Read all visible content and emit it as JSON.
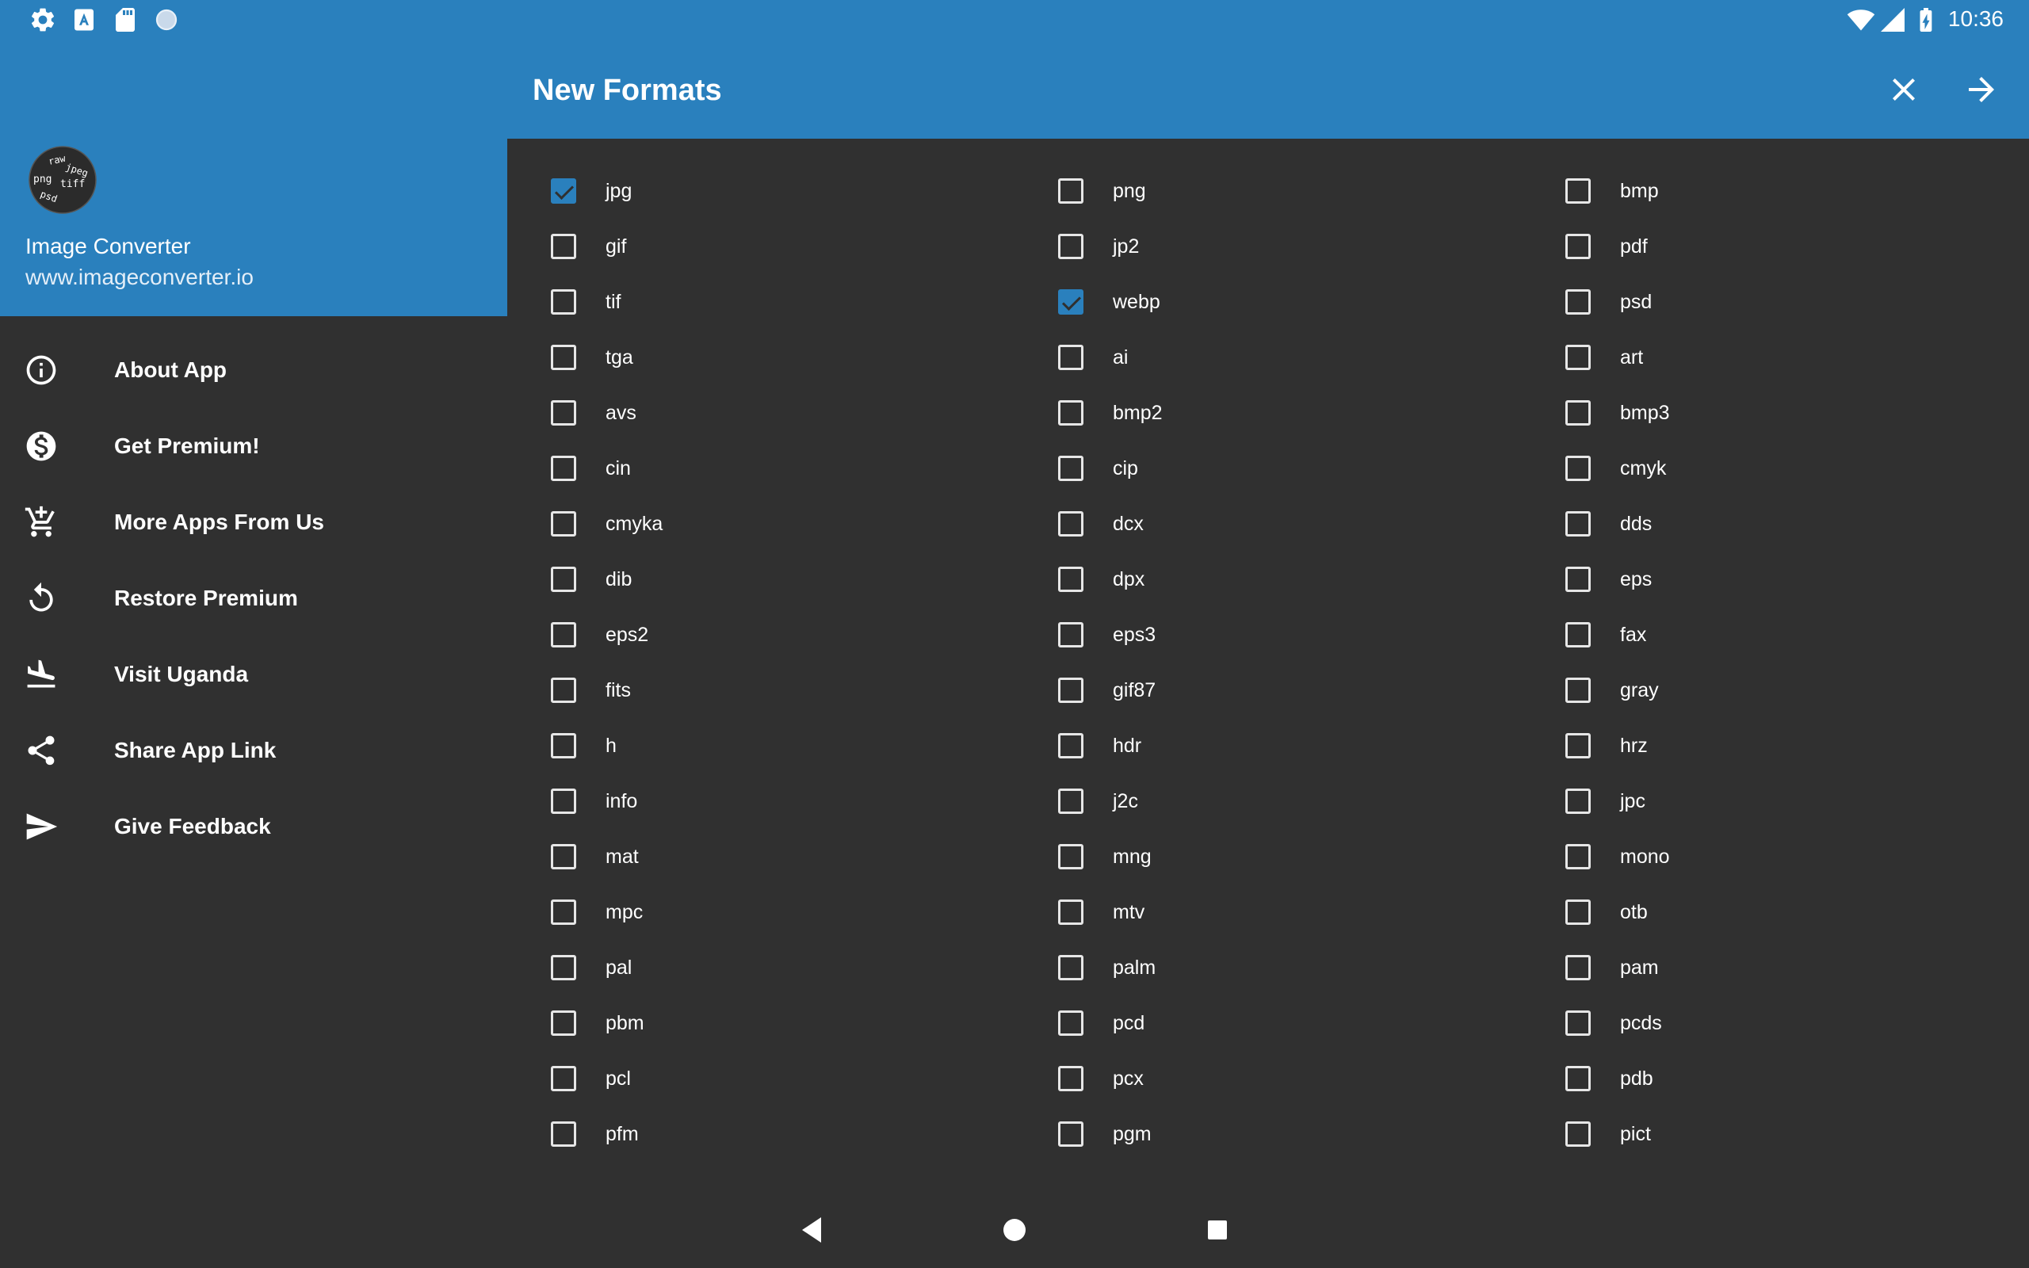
{
  "status_bar": {
    "time": "10:36",
    "left_icons": [
      "gear-icon",
      "font-icon",
      "sd-card-icon",
      "circle-icon"
    ],
    "right_icons": [
      "wifi-icon",
      "signal-icon",
      "battery-charging-icon"
    ]
  },
  "drawer": {
    "app_name": "Image Converter",
    "app_url": "www.imageconverter.io",
    "logo_words": [
      "raw",
      "jpeg",
      "png",
      "tiff",
      "psd"
    ],
    "menu": [
      {
        "label": "About App",
        "icon": "info-icon"
      },
      {
        "label": "Get Premium!",
        "icon": "dollar-icon"
      },
      {
        "label": "More Apps From Us",
        "icon": "add-cart-icon"
      },
      {
        "label": "Restore Premium",
        "icon": "restore-icon"
      },
      {
        "label": "Visit Uganda",
        "icon": "flight-land-icon"
      },
      {
        "label": "Share App Link",
        "icon": "share-icon"
      },
      {
        "label": "Give Feedback",
        "icon": "send-icon"
      }
    ]
  },
  "dialog": {
    "title": "New Formats",
    "close_icon": "close-icon",
    "next_icon": "arrow-forward-icon",
    "formats": [
      {
        "label": "jpg",
        "checked": true
      },
      {
        "label": "png",
        "checked": false
      },
      {
        "label": "bmp",
        "checked": false
      },
      {
        "label": "gif",
        "checked": false
      },
      {
        "label": "jp2",
        "checked": false
      },
      {
        "label": "pdf",
        "checked": false
      },
      {
        "label": "tif",
        "checked": false
      },
      {
        "label": "webp",
        "checked": true
      },
      {
        "label": "psd",
        "checked": false
      },
      {
        "label": "tga",
        "checked": false
      },
      {
        "label": "ai",
        "checked": false
      },
      {
        "label": "art",
        "checked": false
      },
      {
        "label": "avs",
        "checked": false
      },
      {
        "label": "bmp2",
        "checked": false
      },
      {
        "label": "bmp3",
        "checked": false
      },
      {
        "label": "cin",
        "checked": false
      },
      {
        "label": "cip",
        "checked": false
      },
      {
        "label": "cmyk",
        "checked": false
      },
      {
        "label": "cmyka",
        "checked": false
      },
      {
        "label": "dcx",
        "checked": false
      },
      {
        "label": "dds",
        "checked": false
      },
      {
        "label": "dib",
        "checked": false
      },
      {
        "label": "dpx",
        "checked": false
      },
      {
        "label": "eps",
        "checked": false
      },
      {
        "label": "eps2",
        "checked": false
      },
      {
        "label": "eps3",
        "checked": false
      },
      {
        "label": "fax",
        "checked": false
      },
      {
        "label": "fits",
        "checked": false
      },
      {
        "label": "gif87",
        "checked": false
      },
      {
        "label": "gray",
        "checked": false
      },
      {
        "label": "h",
        "checked": false
      },
      {
        "label": "hdr",
        "checked": false
      },
      {
        "label": "hrz",
        "checked": false
      },
      {
        "label": "info",
        "checked": false
      },
      {
        "label": "j2c",
        "checked": false
      },
      {
        "label": "jpc",
        "checked": false
      },
      {
        "label": "mat",
        "checked": false
      },
      {
        "label": "mng",
        "checked": false
      },
      {
        "label": "mono",
        "checked": false
      },
      {
        "label": "mpc",
        "checked": false
      },
      {
        "label": "mtv",
        "checked": false
      },
      {
        "label": "otb",
        "checked": false
      },
      {
        "label": "pal",
        "checked": false
      },
      {
        "label": "palm",
        "checked": false
      },
      {
        "label": "pam",
        "checked": false
      },
      {
        "label": "pbm",
        "checked": false
      },
      {
        "label": "pcd",
        "checked": false
      },
      {
        "label": "pcds",
        "checked": false
      },
      {
        "label": "pcl",
        "checked": false
      },
      {
        "label": "pcx",
        "checked": false
      },
      {
        "label": "pdb",
        "checked": false
      },
      {
        "label": "pfm",
        "checked": false
      },
      {
        "label": "pgm",
        "checked": false
      },
      {
        "label": "pict",
        "checked": false
      }
    ]
  },
  "nav_bar": {
    "icons": [
      "back-icon",
      "home-icon",
      "recents-icon"
    ]
  },
  "colors": {
    "accent": "#2a80bd",
    "background": "#303030",
    "text": "#ffffff"
  }
}
